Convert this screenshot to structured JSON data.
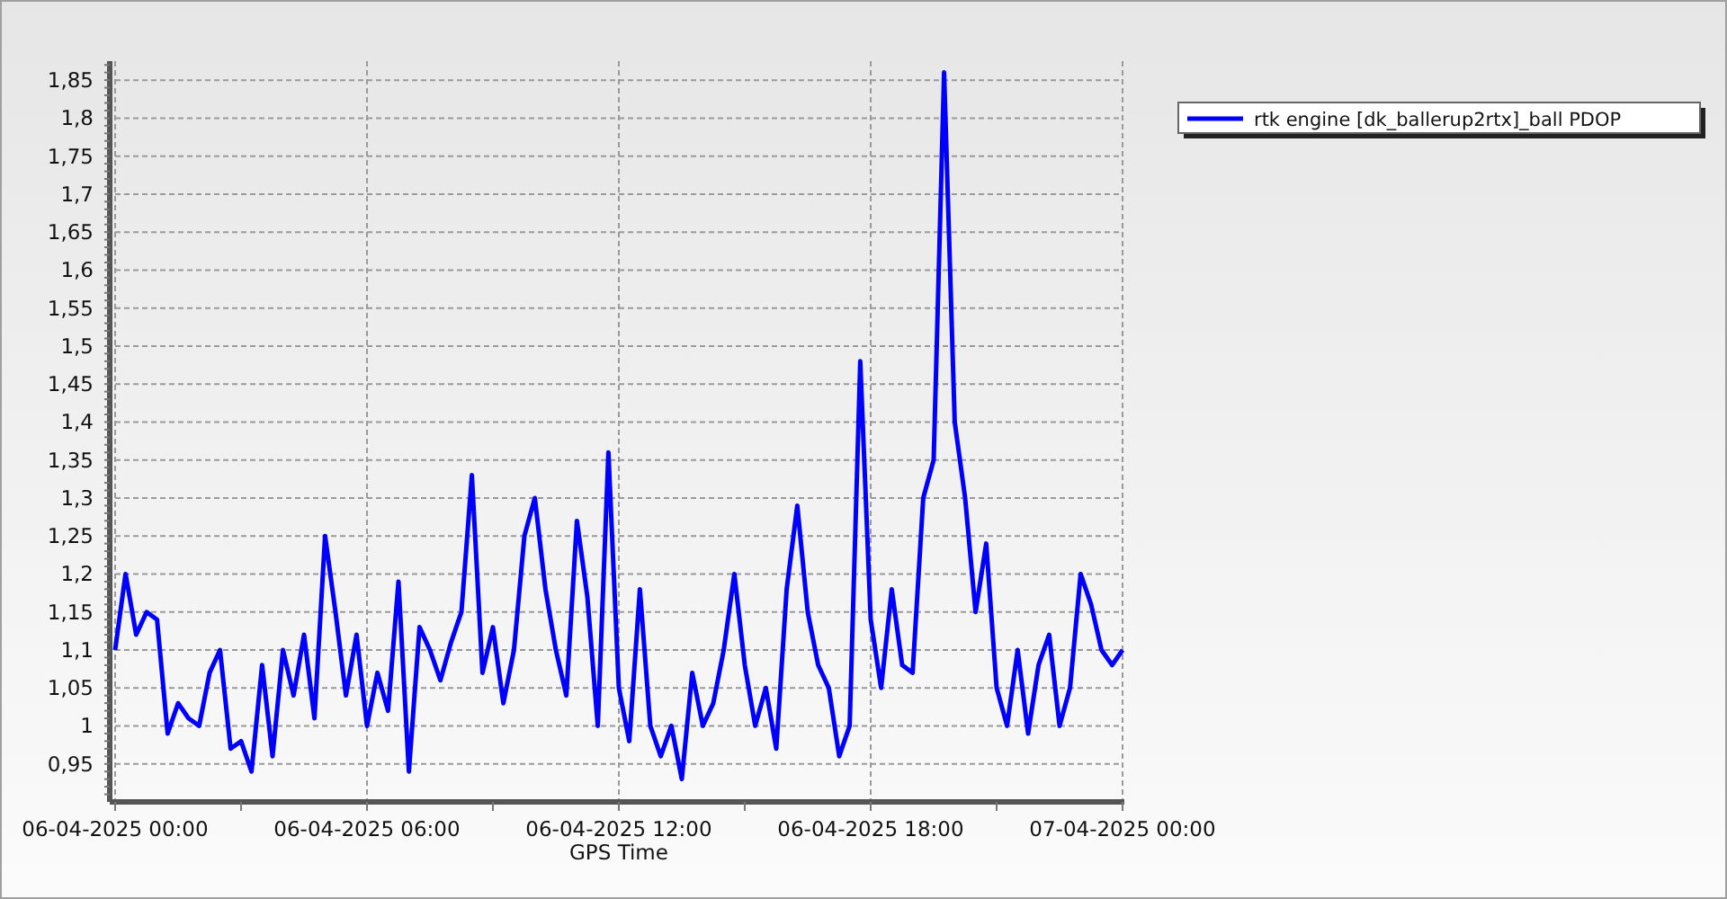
{
  "chart_data": {
    "type": "line",
    "xlabel": "GPS Time",
    "grid": true,
    "categories": [
      "06-04-2025 00:00",
      null,
      null,
      null,
      null,
      null,
      null,
      null,
      null,
      null,
      null,
      null,
      null,
      null,
      null,
      null,
      null,
      null,
      null,
      null,
      null,
      null,
      null,
      null,
      "06-04-2025 06:00",
      null,
      null,
      null,
      null,
      null,
      null,
      null,
      null,
      null,
      null,
      null,
      null,
      null,
      null,
      null,
      null,
      null,
      null,
      null,
      null,
      null,
      null,
      null,
      "06-04-2025 12:00",
      null,
      null,
      null,
      null,
      null,
      null,
      null,
      null,
      null,
      null,
      null,
      null,
      null,
      null,
      null,
      null,
      null,
      null,
      null,
      null,
      null,
      null,
      null,
      "06-04-2025 18:00",
      null,
      null,
      null,
      null,
      null,
      null,
      null,
      null,
      null,
      null,
      null,
      null,
      null,
      null,
      null,
      null,
      null,
      null,
      null,
      null,
      null,
      null,
      null,
      "07-04-2025 00:00"
    ],
    "series": [
      {
        "name": "rtk engine [dk_ballerup2rtx]_ball PDOP",
        "color": "#0000ff",
        "values": [
          1.1,
          1.2,
          1.12,
          1.15,
          1.14,
          0.99,
          1.03,
          1.01,
          1.0,
          1.07,
          1.1,
          0.97,
          0.98,
          0.94,
          1.08,
          0.96,
          1.1,
          1.04,
          1.12,
          1.01,
          1.25,
          1.15,
          1.04,
          1.12,
          1.0,
          1.07,
          1.02,
          1.19,
          0.94,
          1.13,
          1.1,
          1.06,
          1.11,
          1.15,
          1.33,
          1.07,
          1.13,
          1.03,
          1.1,
          1.25,
          1.3,
          1.18,
          1.1,
          1.04,
          1.27,
          1.17,
          1.0,
          1.36,
          1.05,
          0.98,
          1.18,
          1.0,
          0.96,
          1.0,
          0.93,
          1.07,
          1.0,
          1.03,
          1.1,
          1.2,
          1.08,
          1.0,
          1.05,
          0.97,
          1.18,
          1.29,
          1.15,
          1.08,
          1.05,
          0.96,
          1.0,
          1.48,
          1.14,
          1.05,
          1.18,
          1.08,
          1.07,
          1.3,
          1.35,
          1.86,
          1.4,
          1.3,
          1.15,
          1.24,
          1.05,
          1.0,
          1.1,
          0.99,
          1.08,
          1.12,
          1.0,
          1.05,
          1.2,
          1.16,
          1.1,
          1.08,
          1.1
        ]
      }
    ],
    "ylim": [
      0.9,
      1.875
    ],
    "yticks": [
      {
        "value": 0.95,
        "label": "0,95"
      },
      {
        "value": 1,
        "label": "1"
      },
      {
        "value": 1.05,
        "label": "1,05"
      },
      {
        "value": 1.1,
        "label": "1,1"
      },
      {
        "value": 1.15,
        "label": "1,15"
      },
      {
        "value": 1.2,
        "label": "1,2"
      },
      {
        "value": 1.25,
        "label": "1,25"
      },
      {
        "value": 1.3,
        "label": "1,3"
      },
      {
        "value": 1.35,
        "label": "1,35"
      },
      {
        "value": 1.4,
        "label": "1,4"
      },
      {
        "value": 1.45,
        "label": "1,45"
      },
      {
        "value": 1.5,
        "label": "1,5"
      },
      {
        "value": 1.55,
        "label": "1,55"
      },
      {
        "value": 1.6,
        "label": "1,6"
      },
      {
        "value": 1.65,
        "label": "1,65"
      },
      {
        "value": 1.7,
        "label": "1,7"
      },
      {
        "value": 1.75,
        "label": "1,75"
      },
      {
        "value": 1.8,
        "label": "1,8"
      },
      {
        "value": 1.85,
        "label": "1,85"
      }
    ]
  }
}
